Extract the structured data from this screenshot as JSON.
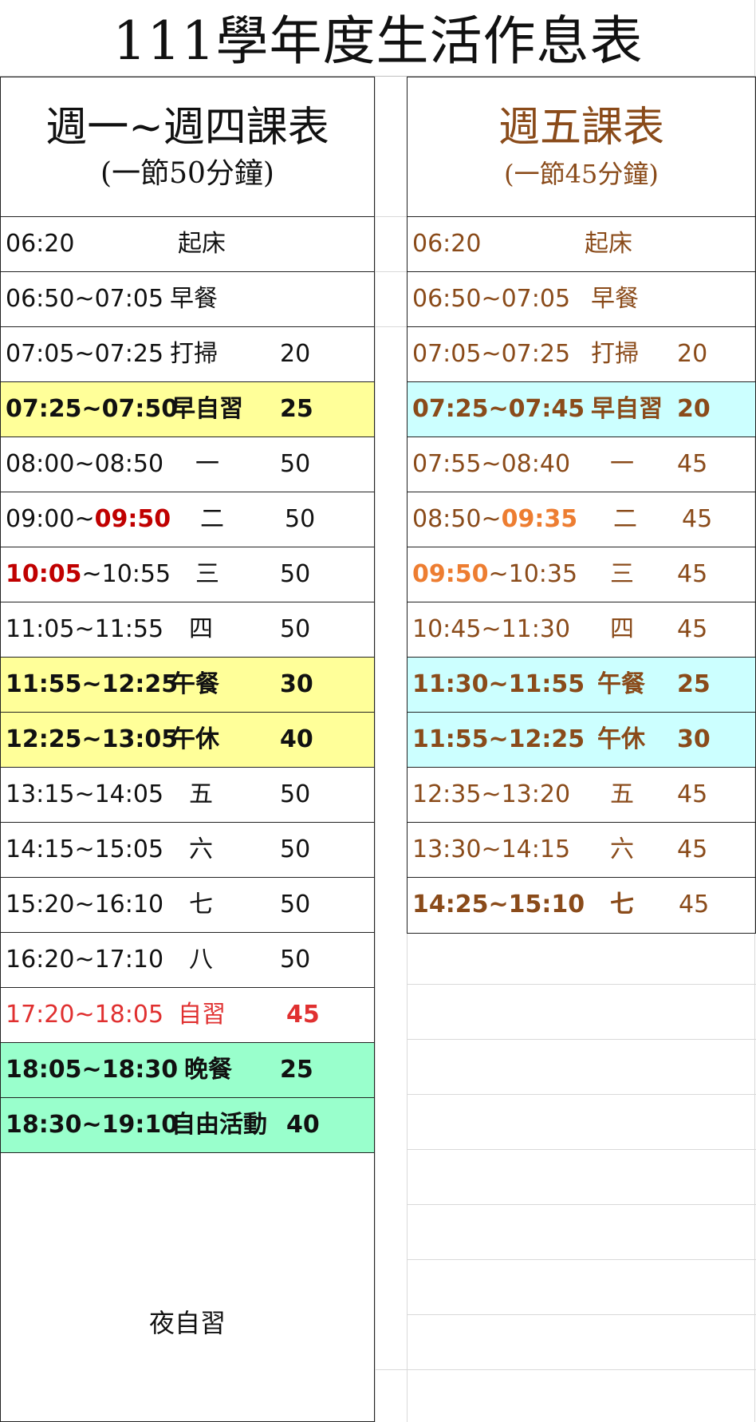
{
  "title": "111學年度生活作息表",
  "colors": {
    "yellow_highlight": "#ffff99",
    "cyan_highlight": "#ccffff",
    "mint_highlight": "#99ffcc",
    "brown_text": "#8a4b1a",
    "red_text": "#c00000",
    "orange_text": "#ed7d31",
    "self_study_red": "#e03030"
  },
  "left": {
    "header_main": "週一~週四課表",
    "header_sub": "(一節50分鐘)",
    "rows": [
      {
        "t1": "06:20",
        "t2": "",
        "name": "起床",
        "min": ""
      },
      {
        "t1": "06:50~07:05",
        "t2": "",
        "name": "早餐",
        "min": ""
      },
      {
        "t1": "07:05~07:25",
        "t2": "",
        "name": "打掃",
        "min": "20"
      },
      {
        "t1": "07:25~07:50",
        "t2": "",
        "name": "早自習",
        "min": "25"
      },
      {
        "t1": "08:00~08:50",
        "t2": "",
        "name": "一",
        "min": "50"
      },
      {
        "t1": "09:00~",
        "t2": "09:50",
        "name": "二",
        "min": "50"
      },
      {
        "t1": "10:05",
        "t2": "~10:55",
        "name": "三",
        "min": "50"
      },
      {
        "t1": "11:05~11:55",
        "t2": "",
        "name": "四",
        "min": "50"
      },
      {
        "t1": "11:55~12:25",
        "t2": "",
        "name": "午餐",
        "min": "30"
      },
      {
        "t1": "12:25~13:05",
        "t2": "",
        "name": "午休",
        "min": "40"
      },
      {
        "t1": "13:15~14:05",
        "t2": "",
        "name": "五",
        "min": "50"
      },
      {
        "t1": "14:15~15:05",
        "t2": "",
        "name": "六",
        "min": "50"
      },
      {
        "t1": "15:20~16:10",
        "t2": "",
        "name": "七",
        "min": "50"
      },
      {
        "t1": "16:20~17:10",
        "t2": "",
        "name": "八",
        "min": "50"
      },
      {
        "t1": "17:20~18:05",
        "t2": "",
        "name": "自習",
        "min": "45"
      },
      {
        "t1": "18:05~18:30",
        "t2": "",
        "name": "晚餐",
        "min": "25"
      },
      {
        "t1": "18:30~19:10",
        "t2": "",
        "name": "自由活動",
        "min": "40"
      }
    ],
    "night": "夜自習"
  },
  "right": {
    "header_main": "週五課表",
    "header_sub": "(一節45分鐘)",
    "rows": [
      {
        "t1": "06:20",
        "t2": "",
        "name": "起床",
        "min": ""
      },
      {
        "t1": "06:50~07:05",
        "t2": "",
        "name": "早餐",
        "min": ""
      },
      {
        "t1": "07:05~07:25",
        "t2": "",
        "name": "打掃",
        "min": "20"
      },
      {
        "t1": "07:25~07:45",
        "t2": "",
        "name": "早自習",
        "min": "20"
      },
      {
        "t1": "07:55~08:40",
        "t2": "",
        "name": "一",
        "min": "45"
      },
      {
        "t1": "08:50~",
        "t2": "09:35",
        "name": "二",
        "min": "45"
      },
      {
        "t1": "09:50",
        "t2": "~10:35",
        "name": "三",
        "min": "45"
      },
      {
        "t1": "10:45~11:30",
        "t2": "",
        "name": "四",
        "min": "45"
      },
      {
        "t1": "11:30~11:55",
        "t2": "",
        "name": "午餐",
        "min": "25"
      },
      {
        "t1": "11:55~12:25",
        "t2": "",
        "name": "午休",
        "min": "30"
      },
      {
        "t1": "12:35~13:20",
        "t2": "",
        "name": "五",
        "min": "45"
      },
      {
        "t1": "13:30~14:15",
        "t2": "",
        "name": "六",
        "min": "45"
      },
      {
        "t1": "14:25~15:10",
        "t2": "",
        "name": "七",
        "min": "45"
      }
    ]
  }
}
